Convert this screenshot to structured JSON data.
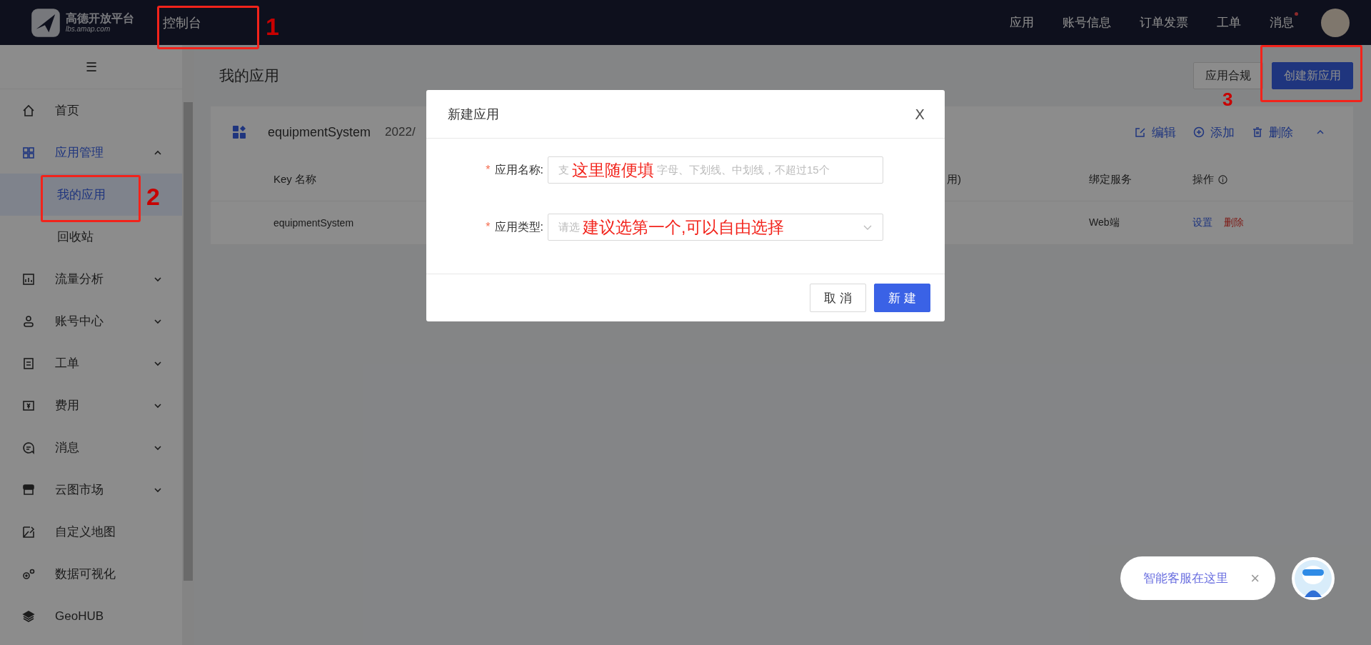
{
  "header": {
    "logo_title": "高德开放平台",
    "logo_url": "lbs.amap.com",
    "console": "控制台",
    "nav": [
      {
        "label": "应用",
        "dot": false
      },
      {
        "label": "账号信息",
        "dot": false
      },
      {
        "label": "订单发票",
        "dot": false
      },
      {
        "label": "工单",
        "dot": false
      },
      {
        "label": "消息",
        "dot": true
      }
    ]
  },
  "sidebar": {
    "menu_icon": "☰",
    "items": [
      {
        "label": "首页",
        "kind": "link",
        "selected": false
      },
      {
        "label": "应用管理",
        "kind": "group",
        "selected": true,
        "expanded": true,
        "children": [
          {
            "label": "我的应用",
            "selected": true
          },
          {
            "label": "回收站",
            "selected": false
          }
        ]
      },
      {
        "label": "流量分析",
        "kind": "group",
        "selected": false,
        "expanded": false
      },
      {
        "label": "账号中心",
        "kind": "group",
        "selected": false,
        "expanded": false
      },
      {
        "label": "工单",
        "kind": "group",
        "selected": false,
        "expanded": false
      },
      {
        "label": "费用",
        "kind": "group",
        "selected": false,
        "expanded": false
      },
      {
        "label": "消息",
        "kind": "group",
        "selected": false,
        "expanded": false
      },
      {
        "label": "云图市场",
        "kind": "group",
        "selected": false,
        "expanded": false
      },
      {
        "label": "自定义地图",
        "kind": "link",
        "selected": false
      },
      {
        "label": "数据可视化",
        "kind": "link",
        "selected": false
      },
      {
        "label": "GeoHUB",
        "kind": "link",
        "selected": false
      }
    ]
  },
  "page": {
    "title": "我的应用",
    "buttons": [
      {
        "label": "应用合规",
        "kind": "default"
      },
      {
        "label": "创建新应用",
        "kind": "primary"
      }
    ]
  },
  "app_card": {
    "name": "equipmentSystem",
    "date": "2022/",
    "actions": [
      {
        "label": "编辑"
      },
      {
        "label": "添加"
      },
      {
        "label": "删除"
      }
    ],
    "table": {
      "columns": [
        "Key 名称",
        "用)",
        "绑定服务",
        "操作"
      ],
      "rows": [
        {
          "name": "equipmentSystem",
          "service": "Web端",
          "links": [
            {
              "label": "设置",
              "kind": "normal"
            },
            {
              "label": "删除",
              "kind": "danger"
            }
          ]
        }
      ]
    }
  },
  "dialog": {
    "title": "新建应用",
    "close": "X",
    "fields": [
      {
        "mark": "*",
        "label": "应用名称:",
        "kind": "input",
        "placeholder_start": "支",
        "hint": "这里随便填",
        "placeholder_end": "字母、下划线、中划线，不超过15个"
      },
      {
        "mark": "*",
        "label": "应用类型:",
        "kind": "select",
        "placeholder_start": "请选",
        "hint": "建议选第一个,可以自由选择"
      }
    ],
    "buttons": [
      {
        "label": "取 消",
        "kind": "default"
      },
      {
        "label": "新 建",
        "kind": "primary"
      }
    ]
  },
  "annotations": [
    "1",
    "2",
    "3"
  ],
  "assistant": {
    "label": "智能客服在这里",
    "close": "×"
  }
}
